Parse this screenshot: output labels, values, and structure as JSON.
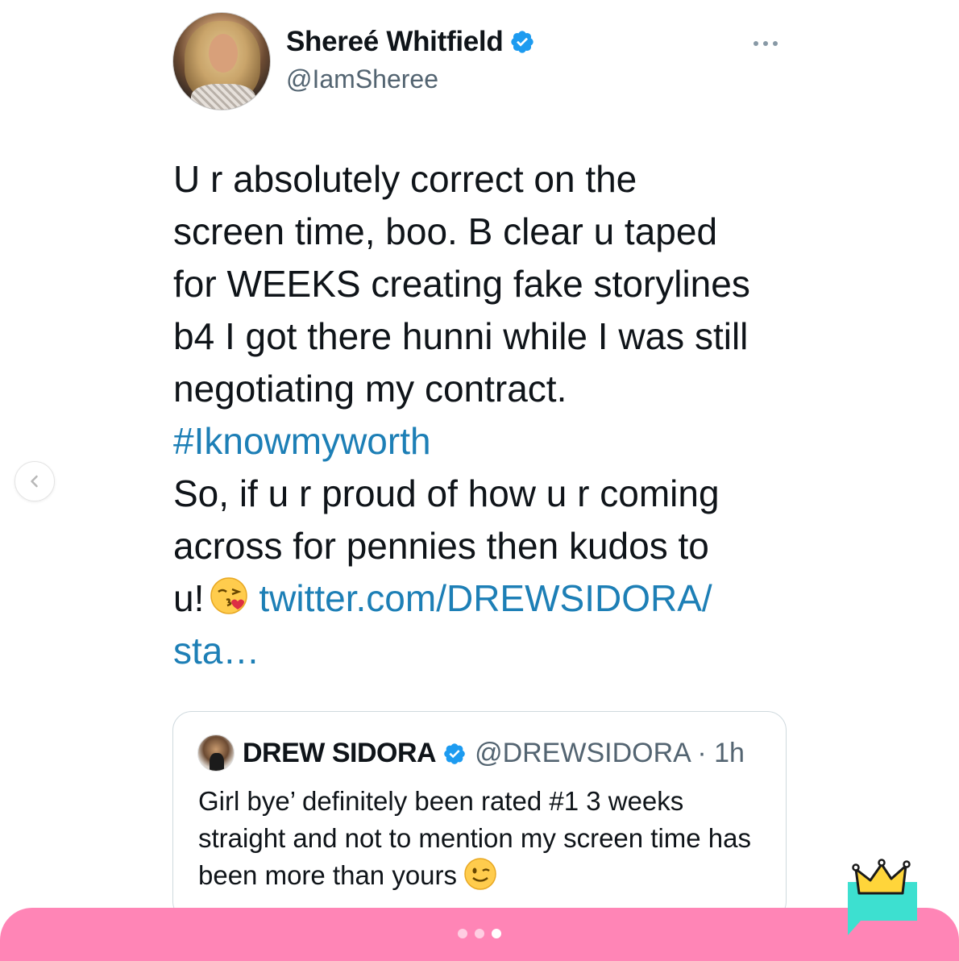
{
  "tweet": {
    "display_name": "Shereé Whitfield",
    "handle": "@IamSheree",
    "text_part1": "U r absolutely correct on the\nscreen time, boo. B clear u taped\nfor WEEKS creating fake storylines\nb4 I got there hunni while I was still\nnegotiating my contract.",
    "hashtag": "#Iknowmyworth",
    "text_part2": "So, if u r proud of how u r coming\nacross for pennies then kudos to\nu!",
    "link_line1": "twitter.com/DREWSIDORA/",
    "link_line2": "sta…"
  },
  "quote": {
    "name": "DREW SIDORA",
    "handle_time": "@DREWSIDORA · 1h",
    "text": "Girl bye’ definitely been rated #1 3 weeks straight and not to mention my screen time has been more than yours"
  },
  "carousel": {
    "dot_count": 3,
    "active_index": 2
  },
  "colors": {
    "link": "#1d7fb6",
    "verified": "#1d9bf0",
    "bottom_bar": "#ff85b6",
    "sticker_bubble": "#3de0d0",
    "crown": "#ffd53a"
  },
  "icons": [
    "verified-badge-icon",
    "more-options-icon",
    "chevron-left-icon",
    "kissing-face-emoji-icon",
    "winking-face-emoji-icon",
    "crown-sticker-icon"
  ]
}
